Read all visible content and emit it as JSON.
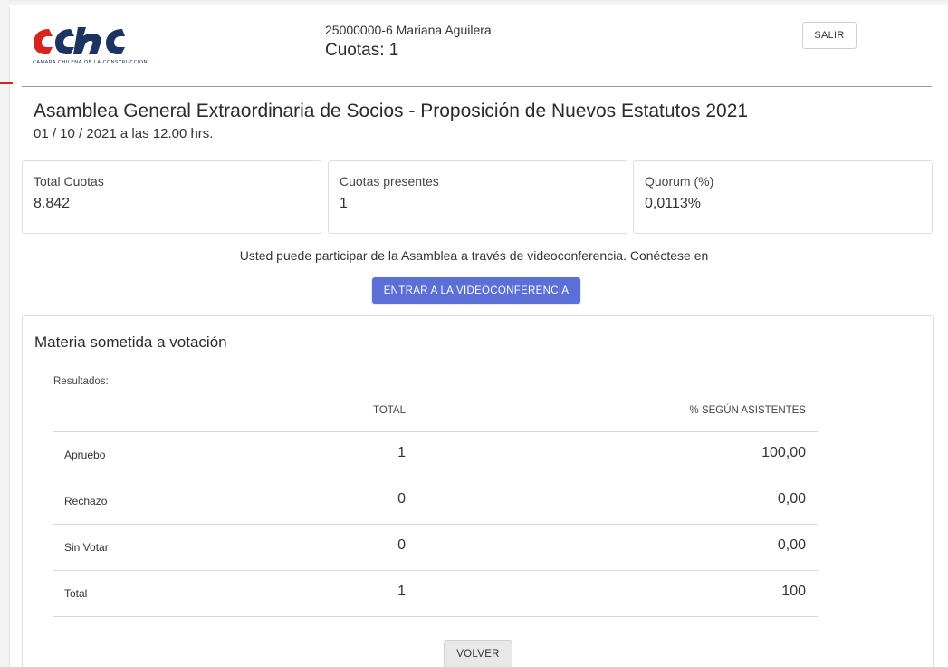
{
  "header": {
    "logo_text": "CAMARA CHILENA DE LA CONSTRUCCION",
    "user": "25000000-6 Mariana Aguilera",
    "cuotas": "Cuotas: 1",
    "logout_label": "SALIR"
  },
  "assembly": {
    "title": "Asamblea General Extraordinaria de Socios - Proposición de Nuevos Estatutos 2021",
    "date": "01 / 10 / 2021 a las 12.00 hrs."
  },
  "stats": [
    {
      "label": "Total Cuotas",
      "value": "8.842"
    },
    {
      "label": "Cuotas presentes",
      "value": "1"
    },
    {
      "label": "Quorum (%)",
      "value": "0,0113%"
    }
  ],
  "video": {
    "note": "Usted puede participar de la Asamblea a través de videoconferencia. Conéctese en",
    "button_label": "ENTRAR A LA VIDEOCONFERENCIA"
  },
  "voting": {
    "title": "Materia sometida a votación",
    "results_label": "Resultados:",
    "columns": {
      "total": "TOTAL",
      "pct": "% SEGÚN ASISTENTES"
    },
    "rows": [
      {
        "label": "Apruebo",
        "total": "1",
        "pct": "100,00"
      },
      {
        "label": "Rechazo",
        "total": "0",
        "pct": "0,00"
      },
      {
        "label": "Sin Votar",
        "total": "0",
        "pct": "0,00"
      },
      {
        "label": "Total",
        "total": "1",
        "pct": "100"
      }
    ],
    "back_label": "VOLVER"
  },
  "colors": {
    "logo_red": "#d9231f",
    "logo_blue": "#1d3462",
    "video_button": "#5b6fd6"
  }
}
